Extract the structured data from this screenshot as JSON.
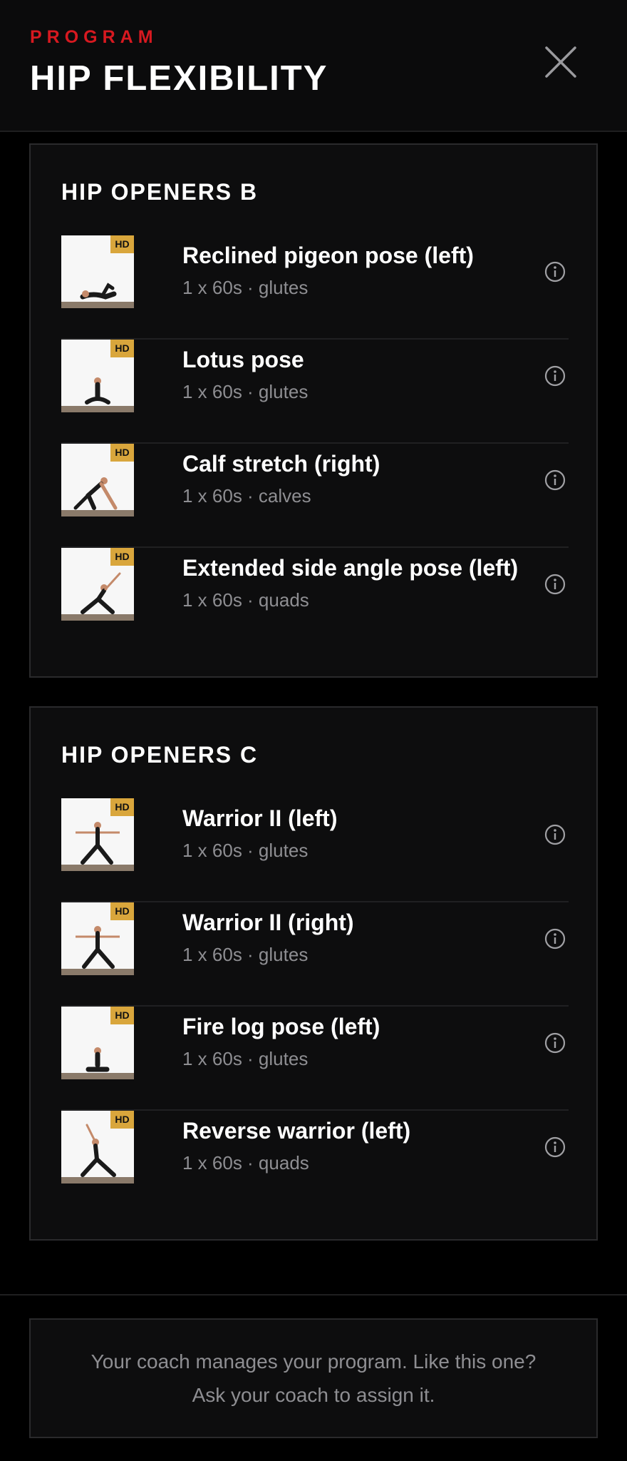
{
  "header": {
    "eyebrow": "PROGRAM",
    "title": "HIP FLEXIBILITY"
  },
  "sections": [
    {
      "title": "HIP OPENERS B",
      "exercises": [
        {
          "name": "Reclined pigeon pose (left)",
          "meta": "1 x 60s · glutes",
          "badge": "HD"
        },
        {
          "name": "Lotus pose",
          "meta": "1 x 60s · glutes",
          "badge": "HD"
        },
        {
          "name": "Calf stretch (right)",
          "meta": "1 x 60s · calves",
          "badge": "HD"
        },
        {
          "name": "Extended side angle pose (left)",
          "meta": "1 x 60s · quads",
          "badge": "HD"
        }
      ]
    },
    {
      "title": "HIP OPENERS C",
      "exercises": [
        {
          "name": "Warrior II (left)",
          "meta": "1 x 60s · glutes",
          "badge": "HD"
        },
        {
          "name": "Warrior II (right)",
          "meta": "1 x 60s · glutes",
          "badge": "HD"
        },
        {
          "name": "Fire log pose (left)",
          "meta": "1 x 60s · glutes",
          "badge": "HD"
        },
        {
          "name": "Reverse warrior (left)",
          "meta": "1 x 60s · quads",
          "badge": "HD"
        }
      ]
    }
  ],
  "footer": {
    "line1": "Your coach manages your program. Like this one?",
    "line2": "Ask your coach to assign it."
  },
  "icons": {
    "close": "close-icon",
    "info": "info-icon",
    "thumbnail": "exercise-thumbnail"
  },
  "colors": {
    "accent": "#d71920",
    "badge": "#d9a63c",
    "background": "#000000",
    "card": "#0d0d0e",
    "muted_text": "#8e8e92"
  }
}
